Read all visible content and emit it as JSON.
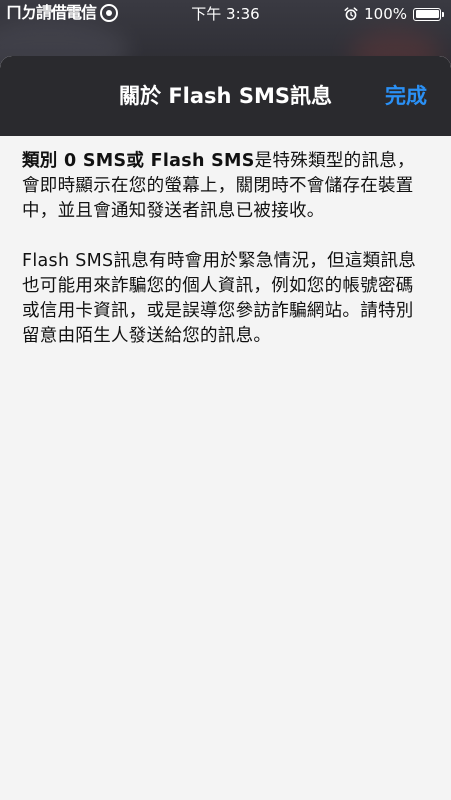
{
  "status_bar": {
    "logo_text": "ㄇㄉ請借電信",
    "time": "下午 3:36",
    "alarm_icon": "alarm-clock-icon",
    "battery_percent_text": "100%",
    "battery_level": 1.0
  },
  "nav": {
    "title": "關於 Flash SMS訊息",
    "done_label": "完成",
    "accent_color": "#2a90f5"
  },
  "content": {
    "para1_bold": "類別 0 SMS或 Flash SMS",
    "para1_rest": "是特殊類型的訊息，會即時顯示在您的螢幕上，關閉時不會儲存在裝置中，並且會通知發送者訊息已被接收。",
    "para2": "Flash SMS訊息有時會用於緊急情況，但這類訊息也可能用來詐騙您的個人資訊，例如您的帳號密碼或信用卡資訊，或是誤導您參訪詐騙網站。請特別留意由陌生人發送給您的訊息。"
  }
}
